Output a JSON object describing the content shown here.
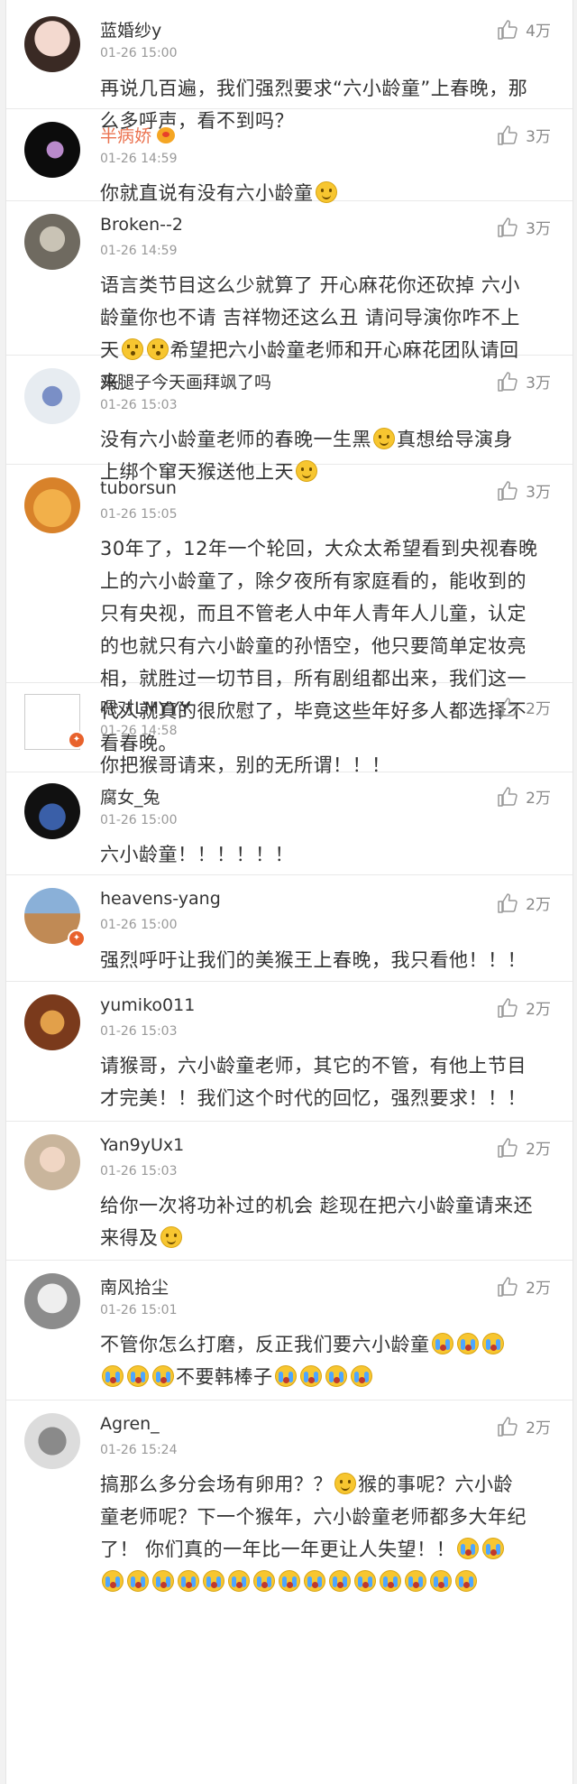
{
  "comments": [
    {
      "user": "蓝婚纱y",
      "time": "01-26 15:00",
      "likes": "4万",
      "lines": [
        "再说几百遍，我们强烈要求“六小龄童”上春晚，那",
        "么多呼声，看不到吗？"
      ]
    },
    {
      "user": "半病娇",
      "time": "01-26 14:59",
      "likes": "3万",
      "lines": [
        "你就直说有没有六小龄童"
      ]
    },
    {
      "user": "Broken--2",
      "time": "01-26 14:59",
      "likes": "3万",
      "lines": [
        "语言类节目这么少就算了 开心麻花你还砍掉 六小",
        "龄童你也不请 吉祥物还这么丑 请问导演你咋不上",
        "天",
        "希望把六小龄童老师和开心麻花团队请回",
        "来"
      ]
    },
    {
      "user": "鸡腿子今天画拜飒了吗",
      "time": "01-26 15:03",
      "likes": "3万",
      "lines": [
        "没有六小龄童老师的春晚一生黑",
        "真想给导演身",
        "上绑个窜天猴送他上天"
      ]
    },
    {
      "user": "tuborsun",
      "time": "01-26 15:05",
      "likes": "3万",
      "lines": [
        "30年了，12年一个轮回，大众太希望看到央视春晚",
        "上的六小龄童了，除夕夜所有家庭看的，能收到的",
        "只有央视，而且不管老人中年人青年人儿童，认定",
        "的也就只有六小龄童的孙悟空，他只要简单定妆亮",
        "相，就胜过一切节目，所有剧组都出来，我们这一",
        "代人就真的很欣慰了，毕竟这些年好多人都选择不",
        "看春晚。"
      ]
    },
    {
      "user": "嗯对LMYYY",
      "time": "01-26 14:58",
      "likes": "2万",
      "lines": [
        "你把猴哥请来，别的无所谓！！！"
      ]
    },
    {
      "user": "腐女_兔",
      "time": "01-26 15:00",
      "likes": "2万",
      "lines": [
        "六小龄童！！！！！！"
      ]
    },
    {
      "user": "heavens-yang",
      "time": "01-26 15:00",
      "likes": "2万",
      "lines": [
        "强烈呼吁让我们的美猴王上春晚，我只看他！！！"
      ]
    },
    {
      "user": "yumiko011",
      "time": "01-26 15:03",
      "likes": "2万",
      "lines": [
        "请猴哥，六小龄童老师，其它的不管，有他上节目",
        "才完美！！我们这个时代的回忆，强烈要求！！！"
      ]
    },
    {
      "user": "Yan9yUx1",
      "time": "01-26 15:03",
      "likes": "2万",
      "lines": [
        "给你一次将功补过的机会 趁现在把六小龄童请来还",
        "来得及"
      ]
    },
    {
      "user": "南风拾尘",
      "time": "01-26 15:01",
      "likes": "2万",
      "lines": [
        "不管你怎么打磨，反正我们要六小龄童",
        "不要韩棒子"
      ]
    },
    {
      "user": "Agren_",
      "time": "01-26 15:24",
      "likes": "2万",
      "lines": [
        "搞那么多分会场有卵用？？",
        "猴的事呢？六小龄",
        "童老师呢？下一个猴年，六小龄童老师都多大年纪",
        "了！ 你们真的一年比一年更让人失望！！"
      ]
    }
  ],
  "icons": {
    "like": "thumbs-up-icon",
    "smile": "smile-emoji-icon",
    "cry": "cry-emoji-icon",
    "puzzle": "puzzled-emoji-icon",
    "verified": "verified-badge-icon",
    "vip": "vip-crown-icon"
  },
  "colors": {
    "vip_name": "#eb7350",
    "text": "#333333",
    "meta": "#999999",
    "divider": "#e9e9e9"
  }
}
